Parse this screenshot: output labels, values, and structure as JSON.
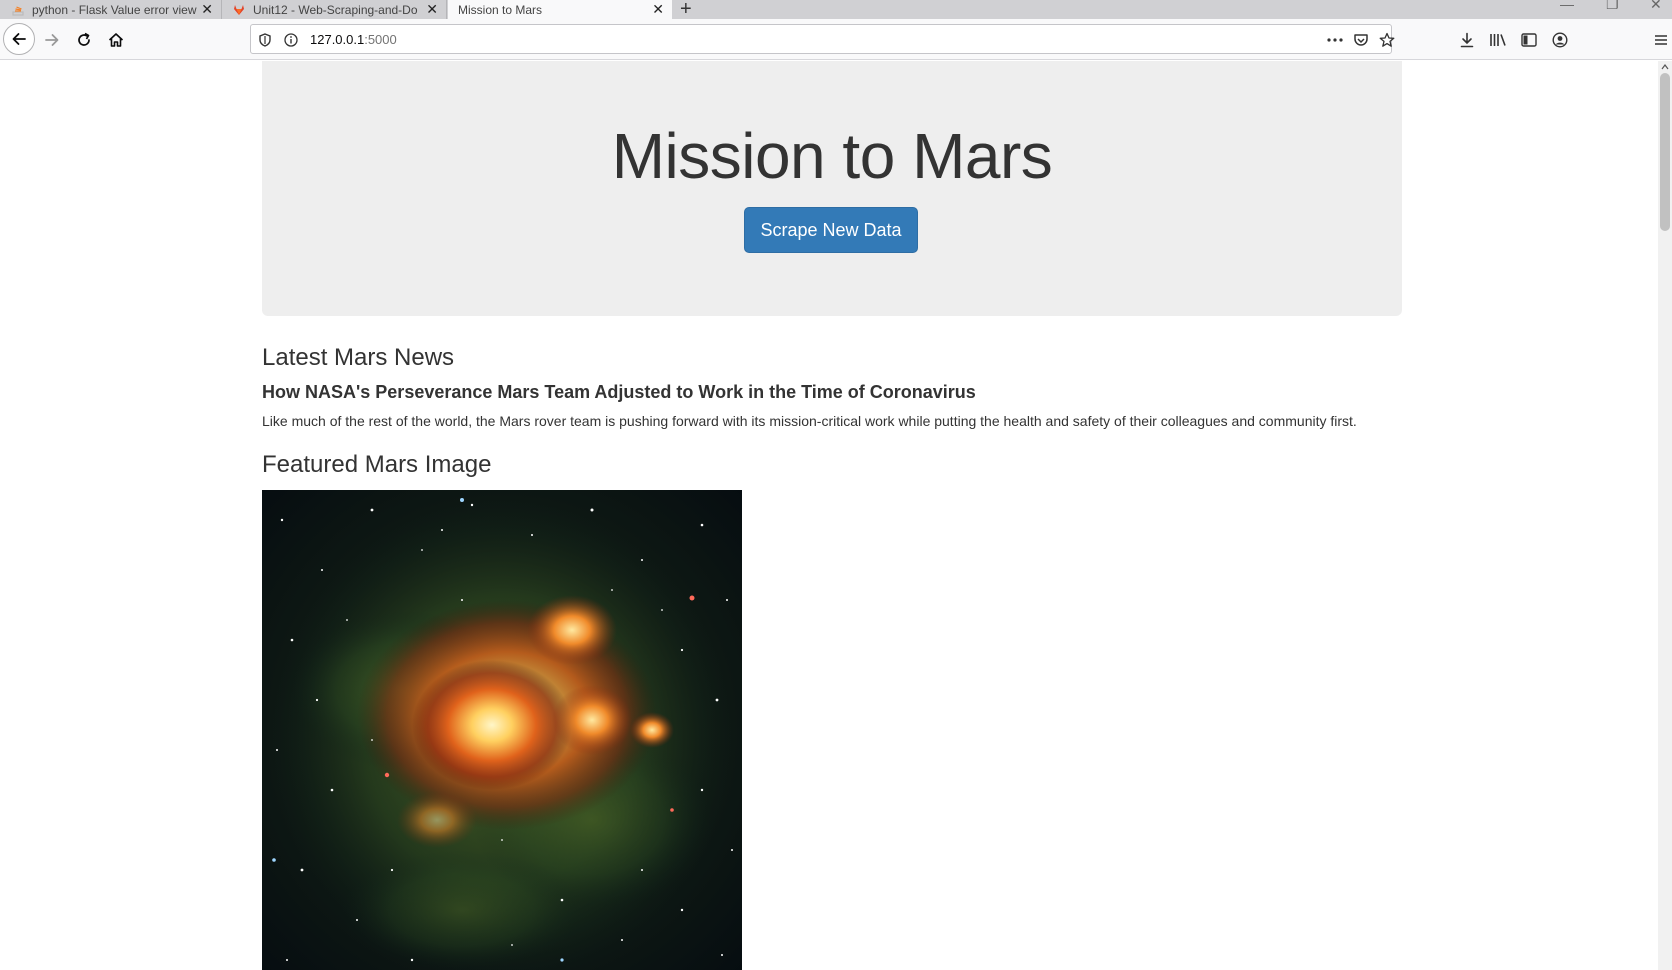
{
  "browser": {
    "tabs": [
      {
        "title": "python - Flask Value error view",
        "active": false
      },
      {
        "title": "Unit12 - Web-Scraping-and-Do",
        "active": false
      },
      {
        "title": "Mission to Mars",
        "active": true
      }
    ],
    "url_host": "127.0.0.1",
    "url_port": ":5000"
  },
  "page": {
    "title": "Mission to Mars",
    "scrape_button": "Scrape New Data",
    "news_heading": "Latest Mars News",
    "news_title": "How NASA's Perseverance Mars Team Adjusted to Work in the Time of Coronavirus",
    "news_paragraph": "Like much of the rest of the world, the Mars rover team is pushing forward with its mission-critical work while putting the health and safety of their colleagues and community first.",
    "featured_heading": "Featured Mars Image"
  },
  "colors": {
    "accent": "#337ab7",
    "jumbotron_bg": "#eeeeee",
    "text": "#333333"
  }
}
